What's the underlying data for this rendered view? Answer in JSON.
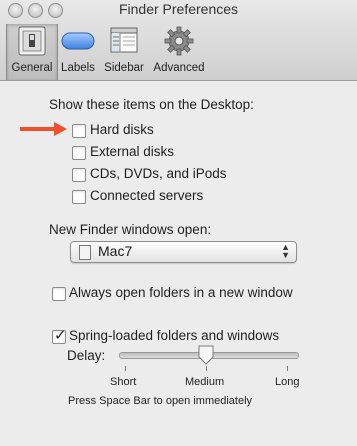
{
  "window": {
    "title": "Finder Preferences"
  },
  "toolbar": {
    "items": [
      {
        "label": "General",
        "icon": "general-switch-icon",
        "selected": true
      },
      {
        "label": "Labels",
        "icon": "label-pill-icon"
      },
      {
        "label": "Sidebar",
        "icon": "sidebar-window-icon"
      },
      {
        "label": "Advanced",
        "icon": "gear-icon"
      }
    ]
  },
  "desktop": {
    "heading": "Show these items on the Desktop:",
    "items": [
      {
        "label": "Hard disks",
        "checked": false
      },
      {
        "label": "External disks",
        "checked": false
      },
      {
        "label": "CDs, DVDs, and iPods",
        "checked": false
      },
      {
        "label": "Connected servers",
        "checked": false
      }
    ]
  },
  "finder_windows": {
    "heading": "New Finder windows open:",
    "selected": "Mac7"
  },
  "always_open": {
    "label": "Always open folders in a new window",
    "checked": false
  },
  "spring_loaded": {
    "label": "Spring-loaded folders and windows",
    "checked": true,
    "delay_label": "Delay:",
    "ticks": [
      "Short",
      "Medium",
      "Long"
    ],
    "value": 0.5,
    "hint": "Press Space Bar to open immediately"
  },
  "colors": {
    "arrow": "#f0502a"
  }
}
